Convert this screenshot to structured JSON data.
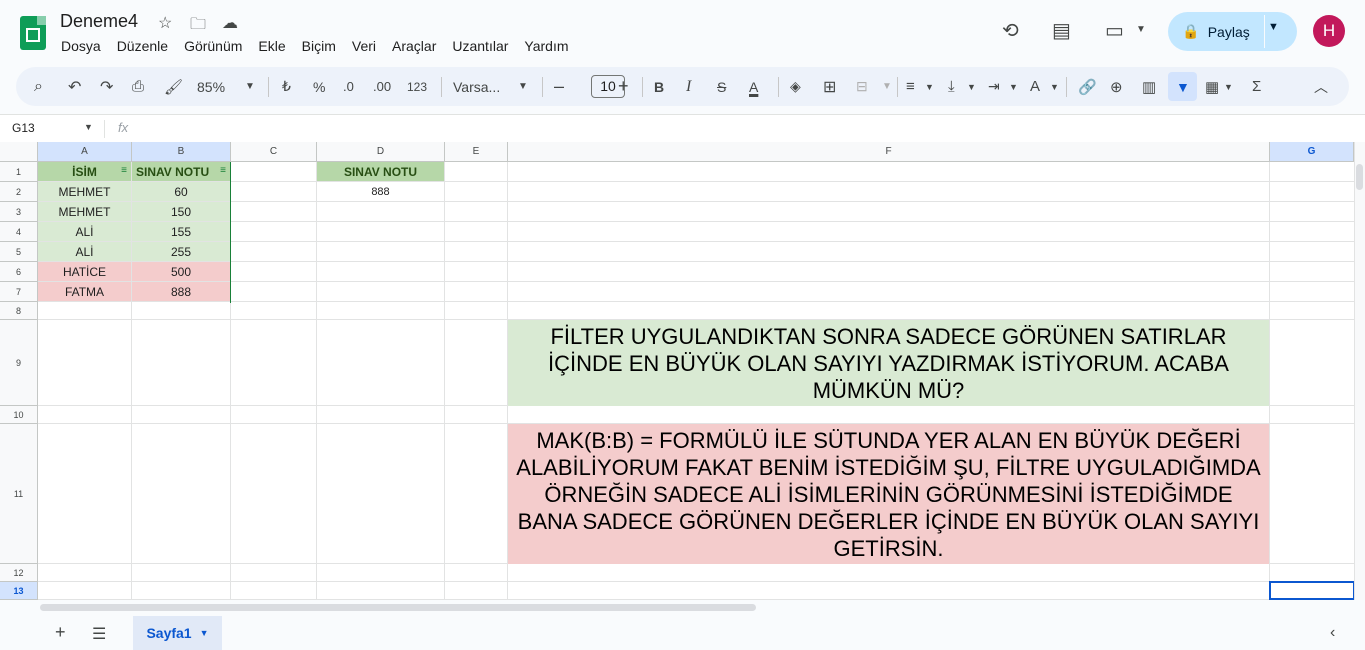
{
  "app": {
    "title": "Deneme4"
  },
  "menu": [
    "Dosya",
    "Düzenle",
    "Görünüm",
    "Ekle",
    "Biçim",
    "Veri",
    "Araçlar",
    "Uzantılar",
    "Yardım"
  ],
  "header": {
    "share_label": "Paylaş",
    "avatar_letter": "H"
  },
  "toolbar": {
    "zoom": "85%",
    "currency": "₺",
    "percent": "%",
    "dec_decrease": ".0",
    "dec_increase": ".00",
    "number_format": "123",
    "font": "Varsa...",
    "font_size": "10",
    "bold": "B",
    "italic": "I",
    "strike": "S",
    "text_color": "A",
    "sum": "Σ"
  },
  "formula_bar": {
    "name_box": "G13",
    "fx": "fx"
  },
  "columns": [
    "A",
    "B",
    "C",
    "D",
    "E",
    "F",
    "G"
  ],
  "rows": [
    "1",
    "2",
    "3",
    "4",
    "5",
    "6",
    "7",
    "8",
    "9",
    "10",
    "11",
    "12",
    "13"
  ],
  "table": {
    "headers": [
      "İSİM",
      "SINAV NOTU"
    ],
    "data": [
      [
        "MEHMET",
        "60"
      ],
      [
        "MEHMET",
        "150"
      ],
      [
        "ALİ",
        "155"
      ],
      [
        "ALİ",
        "255"
      ],
      [
        "HATİCE",
        "500"
      ],
      [
        "FATMA",
        "888"
      ]
    ]
  },
  "d_column": {
    "header": "SINAV NOTU",
    "value": "888"
  },
  "notes": {
    "green": "FİLTER UYGULANDIKTAN SONRA SADECE GÖRÜNEN SATIRLAR İÇİNDE EN BÜYÜK OLAN SAYIYI YAZDIRMAK İSTİYORUM. ACABA MÜMKÜN MÜ?",
    "red": "MAK(B:B) = FORMÜLÜ İLE SÜTUNDA YER ALAN EN BÜYÜK DEĞERİ ALABİLİYORUM FAKAT BENİM İSTEDİĞİM ŞU, FİLTRE UYGULADIĞIMDA ÖRNEĞİN SADECE ALİ İSİMLERİNİN GÖRÜNMESİNİ İSTEDİĞİMDE BANA SADECE GÖRÜNEN DEĞERLER İÇİNDE EN BÜYÜK OLAN SAYIYI GETİRSİN."
  },
  "sheets": {
    "active": "Sayfa1"
  },
  "colors": {
    "green_fill": "#d9ead3",
    "header_green": "#b6d7a8",
    "red_fill": "#f4cccc",
    "accent": "#0b57d0"
  }
}
